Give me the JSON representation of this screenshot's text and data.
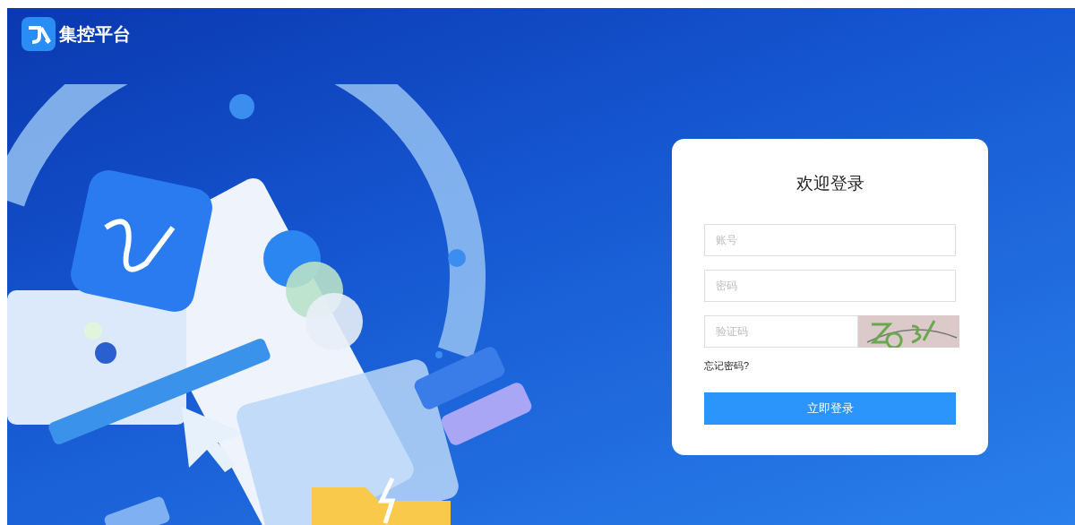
{
  "brand": {
    "name": "集控平台"
  },
  "login": {
    "title": "欢迎登录",
    "fields": [
      {
        "kind": "text",
        "placeholder": "账号"
      },
      {
        "kind": "password",
        "placeholder": "密码"
      },
      {
        "kind": "captcha",
        "placeholder": "验证码"
      }
    ],
    "forgot": "忘记密码?",
    "submit": "立即登录"
  }
}
